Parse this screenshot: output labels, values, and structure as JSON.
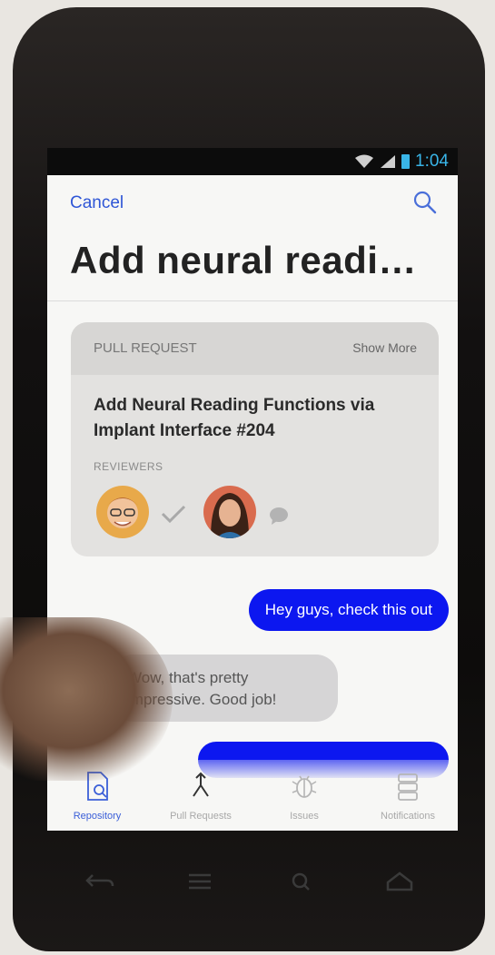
{
  "status_bar": {
    "time": "1:04"
  },
  "header": {
    "cancel_label": "Cancel",
    "title": "Add neural readi…"
  },
  "card": {
    "section_label": "PULL REQUEST",
    "show_more_label": "Show More",
    "title": "Add Neural Reading Functions via Implant Interface #204",
    "reviewers_label": "REVIEWERS"
  },
  "messages": [
    {
      "text": "Hey guys, check this out"
    },
    {
      "text": "Wow, that's pretty impressive. Good job!"
    }
  ],
  "tabs": [
    {
      "label": "Repository"
    },
    {
      "label": "Pull Requests"
    },
    {
      "label": "Issues"
    },
    {
      "label": "Notifications"
    }
  ],
  "colors": {
    "accent": "#2f56d6",
    "bubble_out": "#0c17f0",
    "bubble_in": "#d6d5d6"
  }
}
